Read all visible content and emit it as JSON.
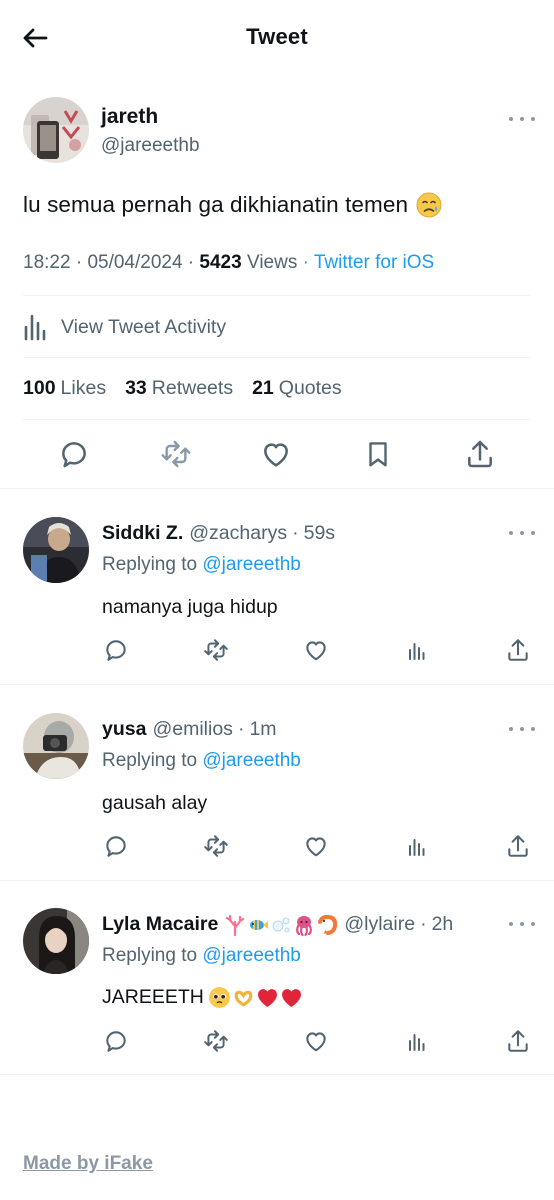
{
  "header": {
    "title": "Tweet"
  },
  "tweet": {
    "author_name": "jareth",
    "author_handle": "@jareeethb",
    "text": "lu semua pernah ga dikhianatin temen",
    "time": "18:22",
    "date": "05/04/2024",
    "views_count": "5423",
    "views_label": "Views",
    "source": "Twitter for iOS",
    "activity_label": "View Tweet Activity",
    "likes_count": "100",
    "likes_label": "Likes",
    "retweets_count": "33",
    "retweets_label": "Retweets",
    "quotes_count": "21",
    "quotes_label": "Quotes"
  },
  "replies": [
    {
      "name": "Siddki Z.",
      "handle": "@zacharys",
      "age": "59s",
      "replying_prefix": "Replying to",
      "replying_to": "@jareeethb",
      "text": "namanya juga hidup"
    },
    {
      "name": "yusa",
      "handle": "@emilios",
      "age": "1m",
      "replying_prefix": "Replying to",
      "replying_to": "@jareeethb",
      "text": "gausah alay"
    },
    {
      "name": "Lyla Macaire",
      "handle": "@lylaire",
      "age": "2h",
      "replying_prefix": "Replying to",
      "replying_to": "@jareeethb",
      "text": "JAREEETH"
    }
  ],
  "footer": {
    "label": "Made by iFake"
  },
  "colors": {
    "accent": "#1d9bf0",
    "text": "#0f1419",
    "muted": "#536471",
    "divider": "#eff3f4"
  },
  "icons": [
    "back-arrow-icon",
    "more-icon",
    "analytics-icon",
    "reply-icon",
    "retweet-icon",
    "like-icon",
    "bookmark-icon",
    "share-icon",
    "views-icon"
  ]
}
